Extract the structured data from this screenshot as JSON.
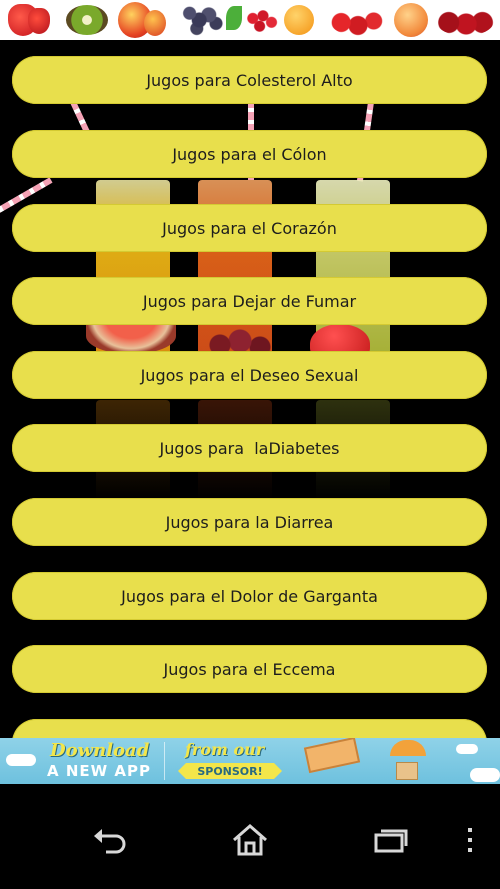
{
  "menu": {
    "items": [
      {
        "label": "Jugos para Colesterol Alto"
      },
      {
        "label": "Jugos para el Cólon"
      },
      {
        "label": "Jugos para el Corazón"
      },
      {
        "label": "Jugos para Dejar de Fumar"
      },
      {
        "label": "Jugos para el Deseo Sexual"
      },
      {
        "label": "Jugos para  laDiabetes"
      },
      {
        "label": "Jugos para la Diarrea"
      },
      {
        "label": "Jugos para el Dolor de Garganta"
      },
      {
        "label": "Jugos para el Eccema"
      },
      {
        "label": ""
      }
    ]
  },
  "ad": {
    "line1": "Download",
    "line2": "A NEW APP",
    "line3": "from our",
    "sponsor": "SPONSOR!"
  },
  "nav": {
    "back_icon": "back-icon",
    "home_icon": "home-icon",
    "recents_icon": "recent-apps-icon",
    "menu_icon": "overflow-menu-icon"
  },
  "colors": {
    "button_bg": "#e8df4c",
    "background": "#000000",
    "ad_bg": "#8fd2e8"
  }
}
